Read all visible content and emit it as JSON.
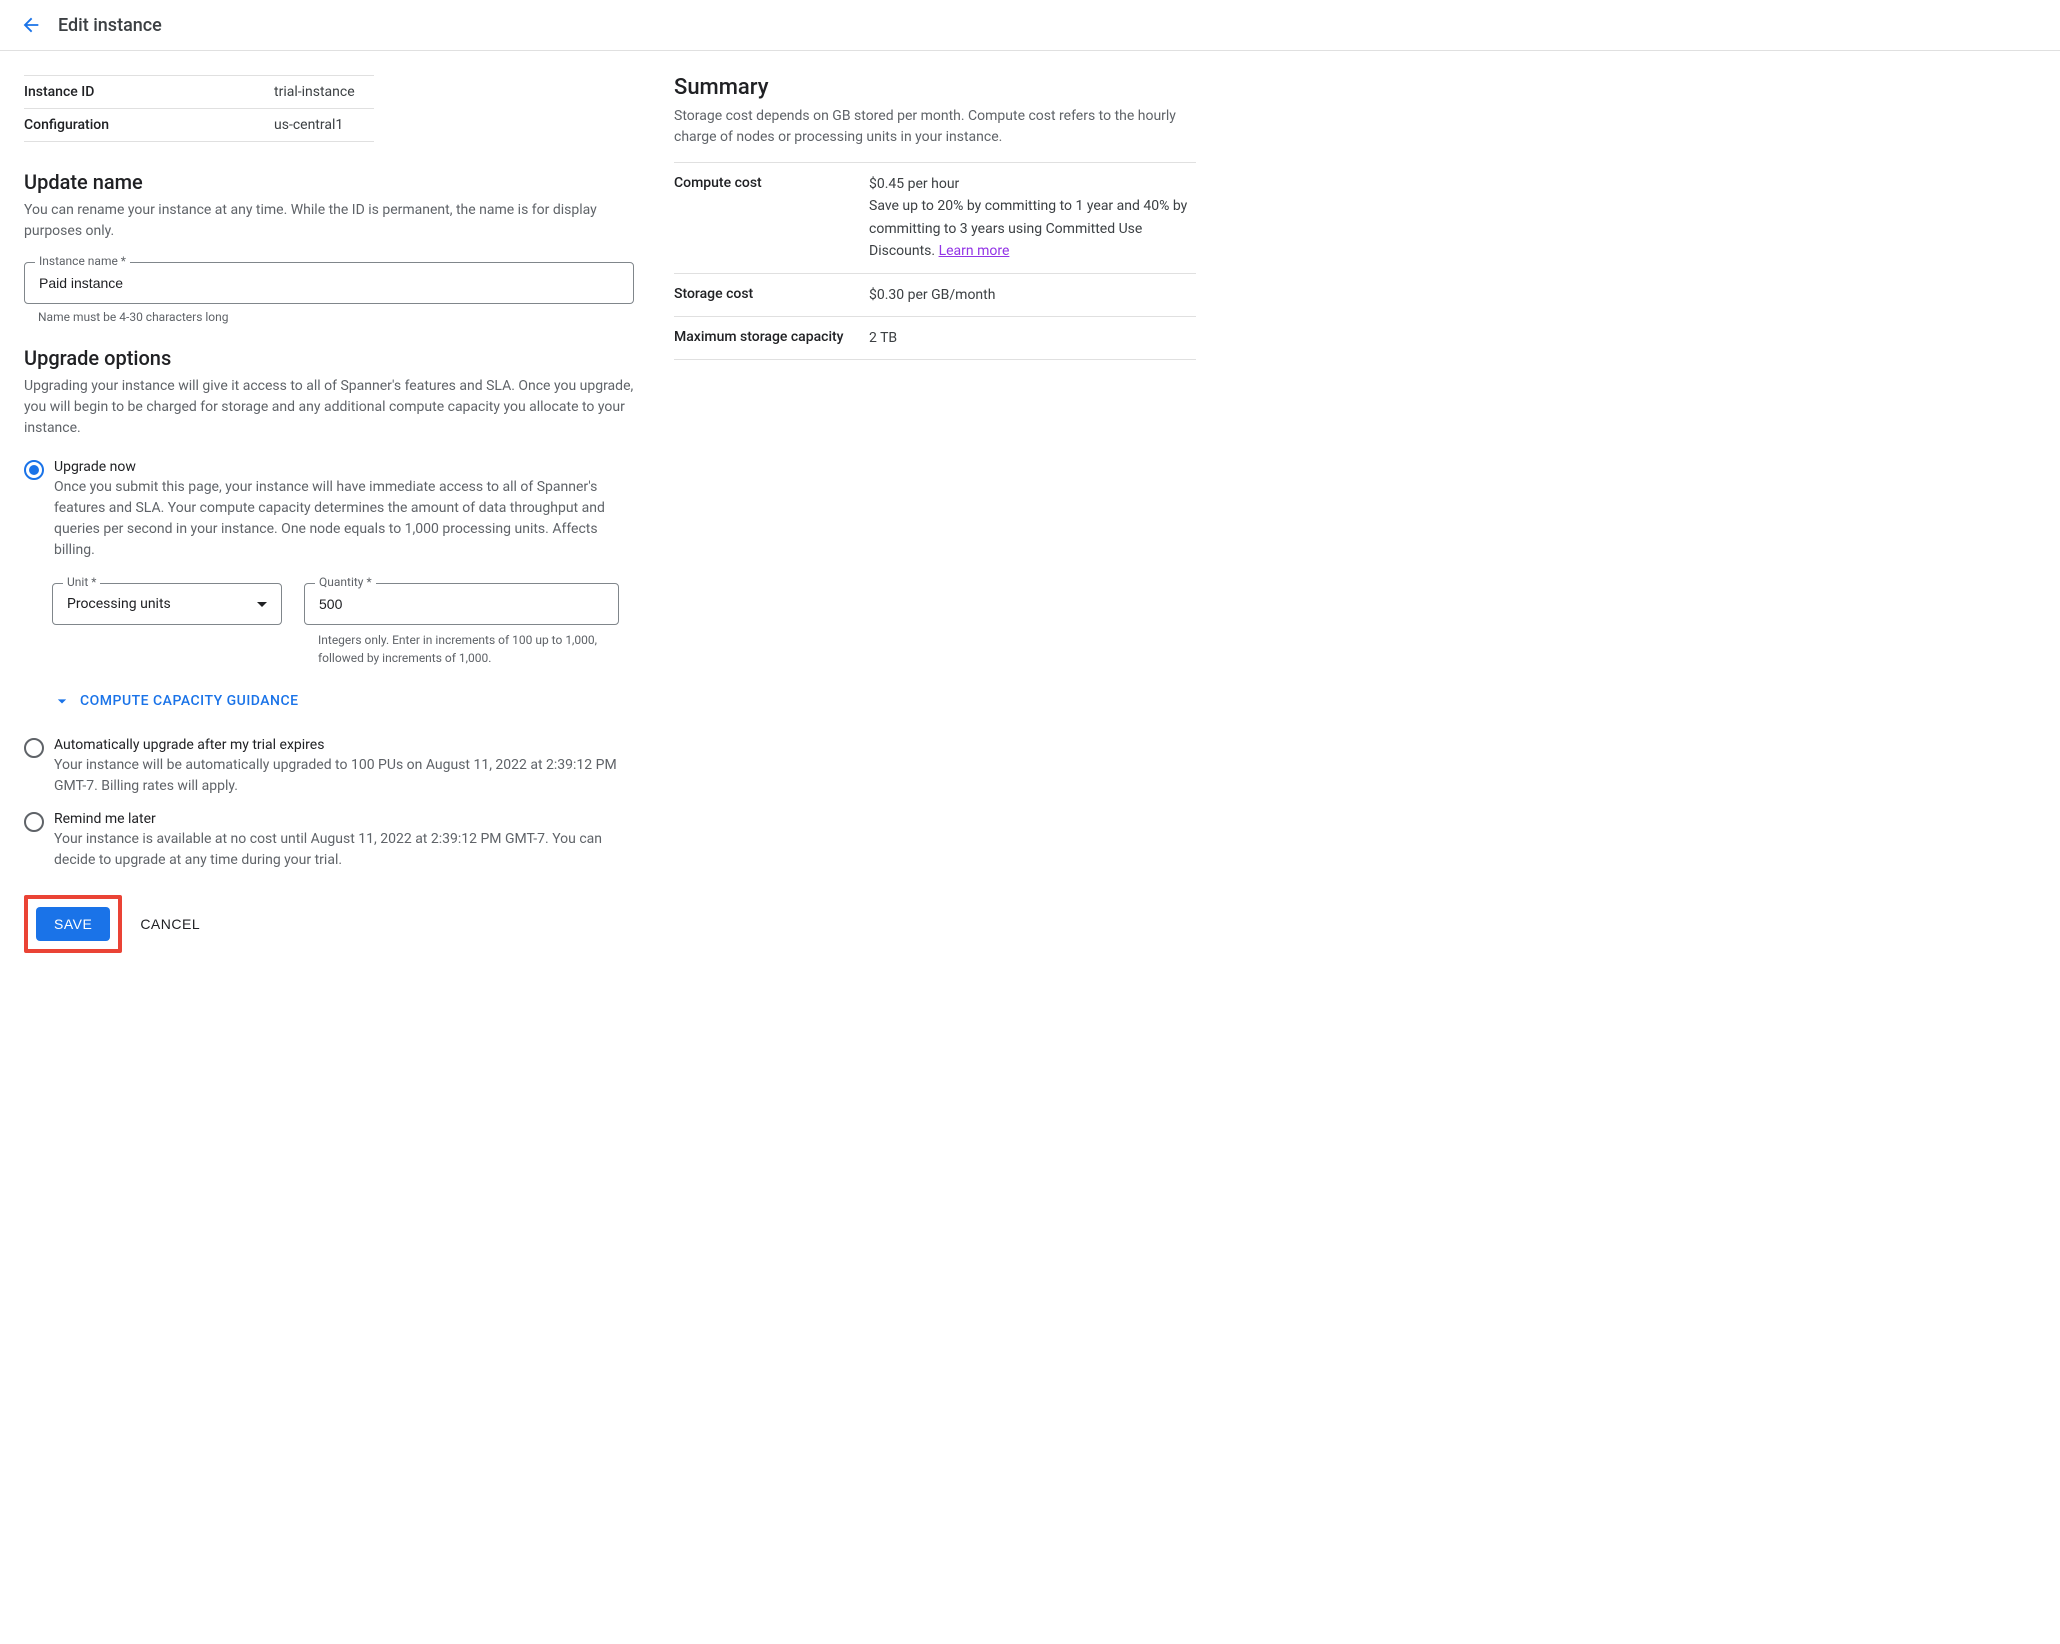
{
  "header": {
    "title": "Edit instance"
  },
  "instance_info": {
    "id_label": "Instance ID",
    "id_value": "trial-instance",
    "config_label": "Configuration",
    "config_value": "us-central1"
  },
  "update_name": {
    "title": "Update name",
    "desc": "You can rename your instance at any time. While the ID is permanent, the name is for display purposes only.",
    "field_label": "Instance name *",
    "field_value": "Paid instance",
    "field_hint": "Name must be 4-30 characters long"
  },
  "upgrade": {
    "title": "Upgrade options",
    "desc": "Upgrading your instance will give it access to all of Spanner's features and SLA. Once you upgrade, you will begin to be charged for storage and any additional compute capacity you allocate to your instance.",
    "option_now": {
      "label": "Upgrade now",
      "desc": "Once you submit this page, your instance will have immediate access to all of Spanner's features and SLA. Your compute capacity determines the amount of data throughput and queries per second in your instance. One node equals to 1,000 processing units. Affects billing.",
      "unit_label": "Unit *",
      "unit_value": "Processing units",
      "qty_label": "Quantity *",
      "qty_value": "500",
      "qty_hint": "Integers only. Enter in increments of 100 up to 1,000, followed by increments of 1,000.",
      "guidance": "COMPUTE CAPACITY GUIDANCE"
    },
    "option_auto": {
      "label": "Automatically upgrade after my trial expires",
      "desc": "Your instance will be automatically upgraded to 100 PUs on August 11, 2022 at 2:39:12 PM GMT-7. Billing rates will apply."
    },
    "option_remind": {
      "label": "Remind me later",
      "desc": "Your instance is available at no cost until August 11, 2022 at 2:39:12 PM GMT-7. You can decide to upgrade at any time during your trial."
    }
  },
  "buttons": {
    "save": "SAVE",
    "cancel": "CANCEL"
  },
  "summary": {
    "title": "Summary",
    "desc": "Storage cost depends on GB stored per month. Compute cost refers to the hourly charge of nodes or processing units in your instance.",
    "compute_label": "Compute cost",
    "compute_value": "$0.45 per hour",
    "compute_note": "Save up to 20% by committing to 1 year and 40% by committing to 3 years using Committed Use Discounts. ",
    "learn_more": "Learn more",
    "storage_label": "Storage cost",
    "storage_value": "$0.30 per GB/month",
    "max_label": "Maximum storage capacity",
    "max_value": "2 TB"
  }
}
